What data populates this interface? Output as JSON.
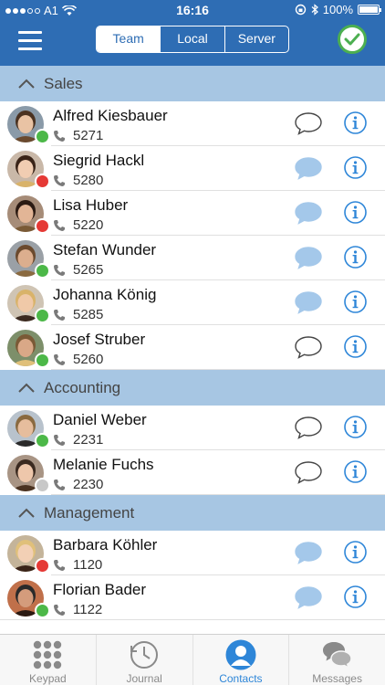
{
  "status_bar": {
    "carrier": "A1",
    "time": "16:16",
    "battery": "100%"
  },
  "nav": {
    "segments": [
      {
        "label": "Team",
        "active": true
      },
      {
        "label": "Local",
        "active": false
      },
      {
        "label": "Server",
        "active": false
      }
    ]
  },
  "groups": [
    {
      "title": "Sales",
      "contacts": [
        {
          "name": "Alfred Kiesbauer",
          "ext": "5271",
          "presence": "online",
          "has_messages": false
        },
        {
          "name": "Siegrid Hackl",
          "ext": "5280",
          "presence": "busy",
          "has_messages": true
        },
        {
          "name": "Lisa Huber",
          "ext": "5220",
          "presence": "busy",
          "has_messages": true
        },
        {
          "name": "Stefan Wunder",
          "ext": "5265",
          "presence": "online",
          "has_messages": true
        },
        {
          "name": "Johanna König",
          "ext": "5285",
          "presence": "online",
          "has_messages": true
        },
        {
          "name": "Josef Struber",
          "ext": "5260",
          "presence": "online",
          "has_messages": false
        }
      ]
    },
    {
      "title": "Accounting",
      "contacts": [
        {
          "name": "Daniel Weber",
          "ext": "2231",
          "presence": "online",
          "has_messages": false
        },
        {
          "name": "Melanie Fuchs",
          "ext": "2230",
          "presence": "offline",
          "has_messages": false
        }
      ]
    },
    {
      "title": "Management",
      "contacts": [
        {
          "name": "Barbara Köhler",
          "ext": "1120",
          "presence": "busy",
          "has_messages": true
        },
        {
          "name": "Florian Bader",
          "ext": "1122",
          "presence": "online",
          "has_messages": true
        }
      ]
    }
  ],
  "tabs": [
    {
      "label": "Keypad",
      "icon": "keypad-icon",
      "active": false
    },
    {
      "label": "Journal",
      "icon": "journal-icon",
      "active": false
    },
    {
      "label": "Contacts",
      "icon": "contacts-icon",
      "active": true
    },
    {
      "label": "Messages",
      "icon": "messages-icon",
      "active": false
    }
  ],
  "colors": {
    "primary": "#2e6db4",
    "group_header": "#a7c6e3",
    "online": "#4cb848",
    "busy": "#e53935",
    "offline": "#c8c8c8",
    "chat_filled": "#a4c8ea",
    "info": "#2e86d8",
    "tab_active": "#2e86d8"
  }
}
